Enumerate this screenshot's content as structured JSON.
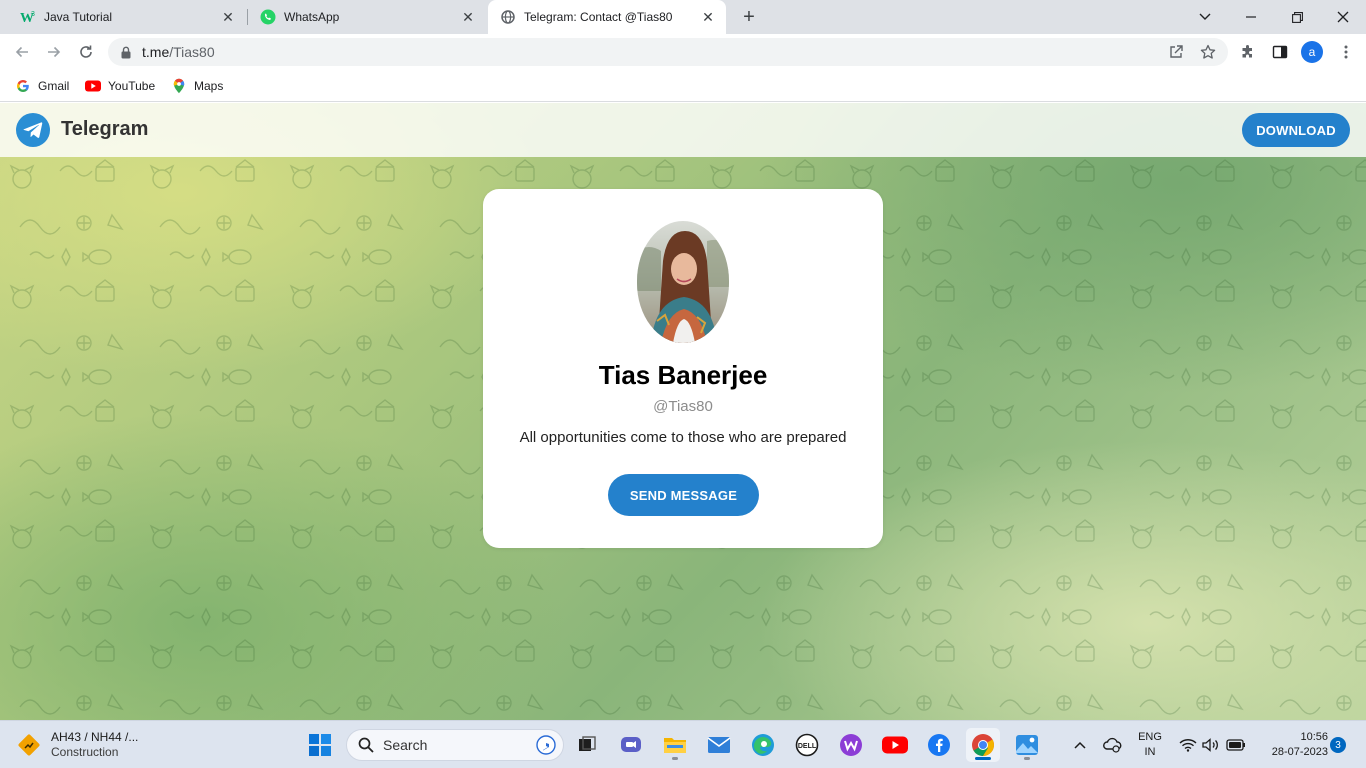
{
  "browser": {
    "tabs": [
      {
        "title": "Java Tutorial",
        "icon": "w3schools-icon",
        "active": false
      },
      {
        "title": "WhatsApp",
        "icon": "whatsapp-icon",
        "active": false
      },
      {
        "title": "Telegram: Contact @Tias80",
        "icon": "globe-icon",
        "active": true
      }
    ],
    "address": {
      "host": "t.me",
      "path": "/Tias80"
    },
    "profile_initial": "a",
    "bookmarks": [
      {
        "label": "Gmail",
        "icon": "google-icon"
      },
      {
        "label": "YouTube",
        "icon": "youtube-icon"
      },
      {
        "label": "Maps",
        "icon": "maps-icon"
      }
    ]
  },
  "telegram": {
    "brand": "Telegram",
    "download_label": "DOWNLOAD",
    "contact": {
      "name": "Tias Banerjee",
      "handle": "@Tias80",
      "bio": "All opportunities come to those who are prepared",
      "send_label": "SEND MESSAGE"
    },
    "colors": {
      "accent": "#2481cc",
      "logo": "#2a8ed4"
    }
  },
  "taskbar": {
    "weather": {
      "title": "AH43 / NH44 /...",
      "subtitle": "Construction"
    },
    "search_placeholder": "Search",
    "apps": [
      "start-icon",
      "task-view-icon",
      "teams-icon",
      "file-explorer-icon",
      "mail-icon",
      "edge-icon",
      "dell-icon",
      "wps-icon",
      "youtube-icon",
      "facebook-icon",
      "chrome-icon",
      "photos-icon"
    ],
    "language": {
      "line1": "ENG",
      "line2": "IN"
    },
    "time": "10:56",
    "date": "28-07-2023",
    "notifications": "3"
  }
}
